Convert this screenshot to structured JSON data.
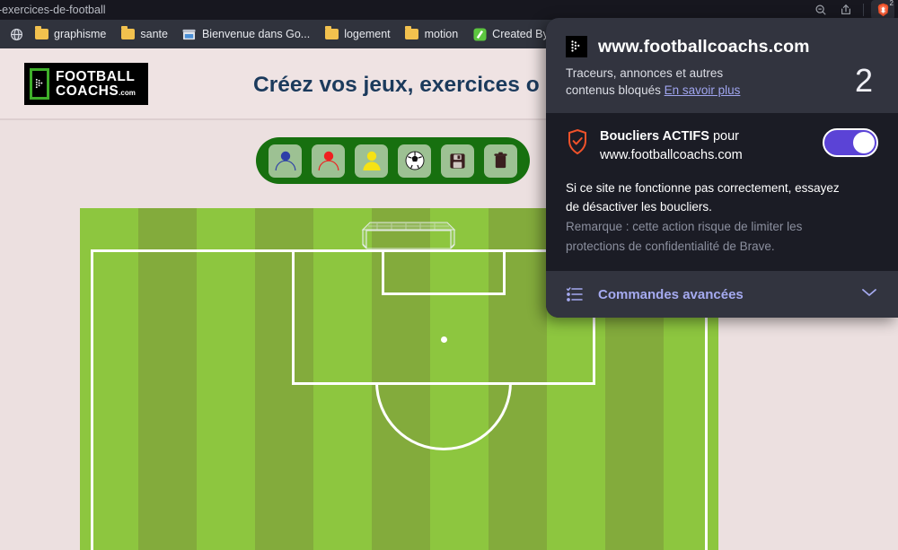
{
  "browser": {
    "tab_title": "-exercices-de-football",
    "actions": [
      {
        "name": "zoom-out-icon",
        "label": ""
      },
      {
        "name": "share-icon",
        "label": ""
      }
    ],
    "shields_badge": "2",
    "bookmarks": [
      {
        "icon": "globe-icon",
        "label": ""
      },
      {
        "icon": "folder-icon",
        "label": "graphisme"
      },
      {
        "icon": "folder-icon",
        "label": "sante"
      },
      {
        "icon": "google-store-icon",
        "label": "Bienvenue dans Go..."
      },
      {
        "icon": "folder-icon",
        "label": "logement"
      },
      {
        "icon": "folder-icon",
        "label": "motion"
      },
      {
        "icon": "green-app-icon",
        "label": "Created By"
      }
    ]
  },
  "site": {
    "logo_line1": "FOOTBALL",
    "logo_line2": "COACHS",
    "logo_domain": ".com",
    "headline": "Créez vos jeux, exercices o",
    "toolbar": [
      {
        "name": "add-blue-player-button",
        "kind": "player-outline",
        "color": "#2d3fa8"
      },
      {
        "name": "add-red-player-button",
        "kind": "player-outline",
        "color": "#ef2020"
      },
      {
        "name": "add-yellow-player-button",
        "kind": "player-filled",
        "color": "#f5e214"
      },
      {
        "name": "add-ball-button",
        "kind": "ball",
        "color": "#ffffff"
      },
      {
        "name": "save-button",
        "kind": "save",
        "color": "#3a1f1f"
      },
      {
        "name": "delete-button",
        "kind": "trash",
        "color": "#3a1f1f"
      }
    ],
    "pitch": {
      "stripe_light": "#8dc63f",
      "stripe_dark": "#83ab3c",
      "line_color": "#ffffff"
    }
  },
  "shields_panel": {
    "favicon": "footballcoachs-favicon",
    "site_url": "www.footballcoachs.com",
    "blocked_text_1": "Traceurs, annonces et autres",
    "blocked_text_2": "contenus bloqués",
    "learn_more": "En savoir plus",
    "blocked_count": "2",
    "shields_status_strong": "Boucliers ACTIFS",
    "shields_status_rest": " pour",
    "shields_status_site": "www.footballcoachs.com",
    "toggle_on": true,
    "note_line1": "Si ce site ne fonctionne pas correctement, essayez",
    "note_line2": "de désactiver les boucliers.",
    "note_line3": "Remarque : cette action risque de limiter les",
    "note_line4": "protections de confidentialité de Brave.",
    "advanced_label": "Commandes avancées",
    "accent": "#5b43d6"
  }
}
